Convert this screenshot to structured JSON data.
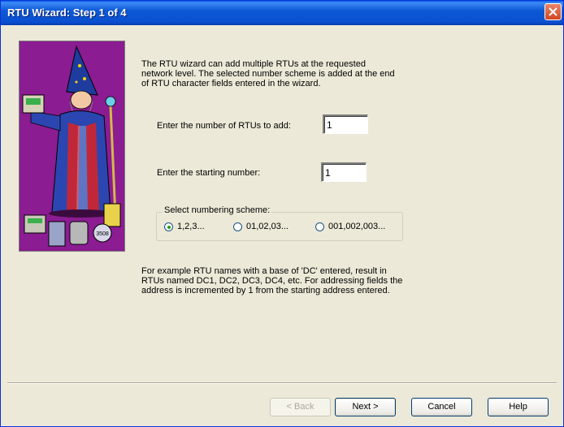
{
  "window": {
    "title": "RTU Wizard: Step 1 of 4"
  },
  "intro": {
    "lines": [
      "The RTU wizard can add multiple RTUs at the requested",
      "network level. The selected number scheme is added at the end",
      "of RTU character fields entered in the wizard."
    ]
  },
  "form": {
    "count_label": "Enter the number of RTUs to add:",
    "count_value": "1",
    "start_label": "Enter the starting number:",
    "start_value": "1",
    "scheme_label": "Select numbering scheme:",
    "scheme_options": [
      "1,2,3...",
      "01,02,03...",
      "001,002,003..."
    ],
    "scheme_selected": "1,2,3..."
  },
  "example": {
    "lines": [
      "For example RTU names with a base of 'DC' entered, result in",
      "RTUs named DC1, DC2, DC3, DC4, etc. For addressing fields the",
      "address is incremented by 1 from the starting address entered."
    ]
  },
  "image": {
    "badge_text": "3508"
  },
  "buttons": {
    "back": "< Back",
    "next": "Next >",
    "cancel": "Cancel",
    "help": "Help"
  },
  "colors": {
    "titlebar": "#0a4fcf",
    "wizard_bg": "#8b1c92",
    "close": "#d2461e"
  }
}
